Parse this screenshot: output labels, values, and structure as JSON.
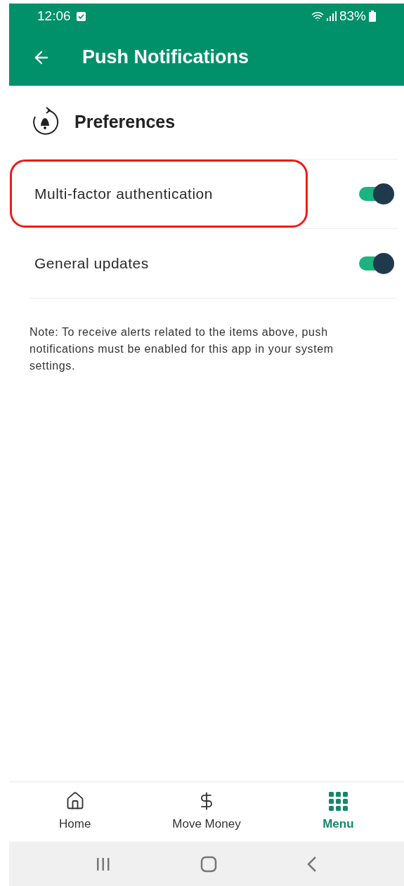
{
  "status_bar": {
    "time": "12:06",
    "battery": "83%"
  },
  "app_bar": {
    "title": "Push Notifications"
  },
  "section": {
    "title": "Preferences"
  },
  "preferences": [
    {
      "label": "Multi-factor authentication",
      "on": true,
      "highlighted": true
    },
    {
      "label": "General updates",
      "on": true,
      "highlighted": false
    }
  ],
  "note": "Note: To receive alerts related to the items above, push notifications must be enabled for this app in your system settings.",
  "bottom_nav": [
    {
      "kind": "home",
      "label": "Home",
      "selected": false
    },
    {
      "kind": "money",
      "label": "Move Money",
      "selected": false
    },
    {
      "kind": "menu",
      "label": "Menu",
      "selected": true
    }
  ]
}
